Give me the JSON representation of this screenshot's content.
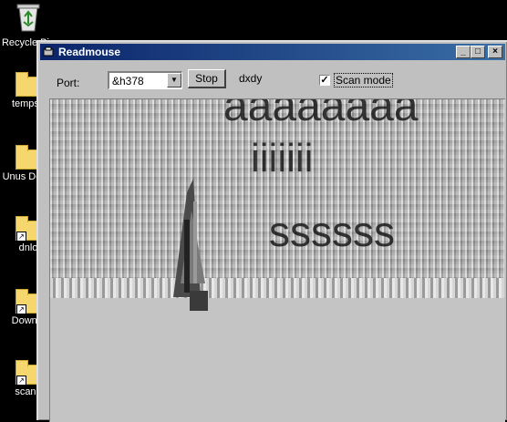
{
  "desktop": {
    "icons": [
      {
        "name": "recycle-bin-icon",
        "label": "Recycle Bin",
        "kind": "recycle"
      },
      {
        "name": "folder-icon",
        "label": "tempse",
        "kind": "folder"
      },
      {
        "name": "folder-icon",
        "label": "Unus Deskt",
        "kind": "folder"
      },
      {
        "name": "shortcut-folder-icon",
        "label": "dnlo",
        "kind": "shortcut"
      },
      {
        "name": "shortcut-folder-icon",
        "label": "Downlo",
        "kind": "shortcut"
      },
      {
        "name": "shortcut-folder-icon",
        "label": "scann",
        "kind": "shortcut"
      }
    ]
  },
  "window": {
    "title": "Readmouse",
    "controls": {
      "minimize": "_",
      "maximize": "□",
      "close": "×"
    },
    "port_label": "Port:",
    "port_value": "&h378",
    "stop_label": "Stop",
    "dxdy_label": "dxdy",
    "scan_mode_label": "Scan mode",
    "scan_mode_checked": true
  },
  "colors": {
    "titlebar_start": "#0a246a",
    "titlebar_end": "#3a6ea5",
    "window_face": "#c0c0c0",
    "desktop": "#000000"
  }
}
